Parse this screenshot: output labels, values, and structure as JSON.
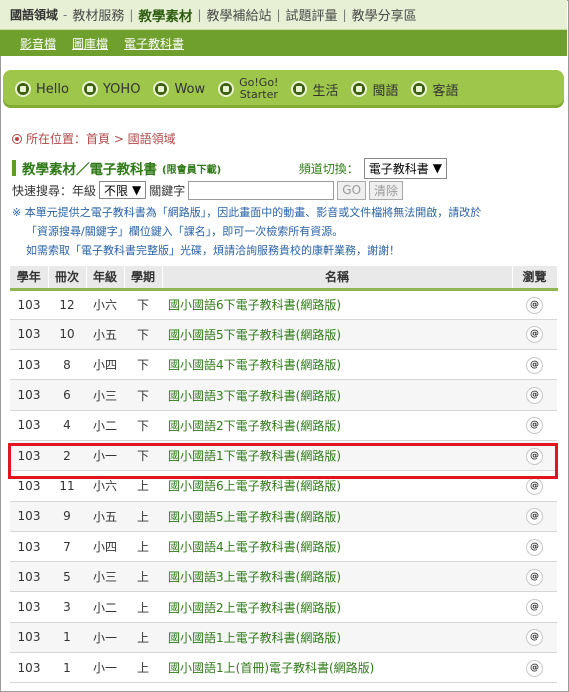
{
  "top_nav": {
    "brand": "國語領域",
    "items": [
      "教材服務",
      "教學素材",
      "教學補給站",
      "試題評量",
      "教學分享區"
    ],
    "active": "教學素材"
  },
  "sub_nav": {
    "items": [
      "影音檔",
      "圖庫檔",
      "電子教科書"
    ]
  },
  "channel_bar": {
    "items": [
      {
        "label": "Hello"
      },
      {
        "label": "YOHO"
      },
      {
        "label": "Wow"
      },
      {
        "label_line1": "Go!Go!",
        "label_line2": "Starter"
      },
      {
        "label": "生活"
      },
      {
        "label": "閩語"
      },
      {
        "label": "客語"
      }
    ]
  },
  "breadcrumb": {
    "text": "所在位置：首頁 > 國語領域"
  },
  "page_title": {
    "title": "教學素材／電子教科書",
    "note": "(限會員下載)",
    "channel_label": "頻道切換：",
    "channel_value": "電子教科書"
  },
  "search": {
    "label": "快速搜尋：年級",
    "grade_value": "不限",
    "keyword_label": "關鍵字",
    "keyword_value": "",
    "go_label": "GO",
    "clear_label": "清除"
  },
  "notice": {
    "line1": "※ 本單元提供之電子教科書為「網路版」，因此畫面中的動畫、影音或文件檔將無法開啟，請改於",
    "line2": "「資源搜尋/關鍵字」欄位鍵入「課名」，即可一次檢索所有資源。",
    "line3": "如需索取「電子教科書完整版」光碟，煩請洽詢服務貴校的康軒業務，謝謝！"
  },
  "table": {
    "headers": [
      "學年",
      "冊次",
      "年級",
      "學期",
      "名稱",
      "瀏覽"
    ],
    "browse_glyph": "@",
    "rows": [
      {
        "year": "103",
        "vol": "12",
        "grade": "小六",
        "term": "下",
        "name": "國小國語6下電子教科書(網路版)"
      },
      {
        "year": "103",
        "vol": "10",
        "grade": "小五",
        "term": "下",
        "name": "國小國語5下電子教科書(網路版)"
      },
      {
        "year": "103",
        "vol": "8",
        "grade": "小四",
        "term": "下",
        "name": "國小國語4下電子教科書(網路版)"
      },
      {
        "year": "103",
        "vol": "6",
        "grade": "小三",
        "term": "下",
        "name": "國小國語3下電子教科書(網路版)"
      },
      {
        "year": "103",
        "vol": "4",
        "grade": "小二",
        "term": "下",
        "name": "國小國語2下電子教科書(網路版)"
      },
      {
        "year": "103",
        "vol": "2",
        "grade": "小一",
        "term": "下",
        "name": "國小國語1下電子教科書(網路版)"
      },
      {
        "year": "103",
        "vol": "11",
        "grade": "小六",
        "term": "上",
        "name": "國小國語6上電子教科書(網路版)"
      },
      {
        "year": "103",
        "vol": "9",
        "grade": "小五",
        "term": "上",
        "name": "國小國語5上電子教科書(網路版)"
      },
      {
        "year": "103",
        "vol": "7",
        "grade": "小四",
        "term": "上",
        "name": "國小國語4上電子教科書(網路版)"
      },
      {
        "year": "103",
        "vol": "5",
        "grade": "小三",
        "term": "上",
        "name": "國小國語3上電子教科書(網路版)"
      },
      {
        "year": "103",
        "vol": "3",
        "grade": "小二",
        "term": "上",
        "name": "國小國語2上電子教科書(網路版)"
      },
      {
        "year": "103",
        "vol": "1",
        "grade": "小一",
        "term": "上",
        "name": "國小國語1上電子教科書(網路版)"
      },
      {
        "year": "103",
        "vol": "1",
        "grade": "小一",
        "term": "上",
        "name": "國小國語1上(首冊)電子教科書(網路版)"
      }
    ]
  },
  "colors": {
    "accent_green": "#6f9f2c",
    "highlight_red": "#e0151e",
    "link_blue": "#2a63a8"
  }
}
